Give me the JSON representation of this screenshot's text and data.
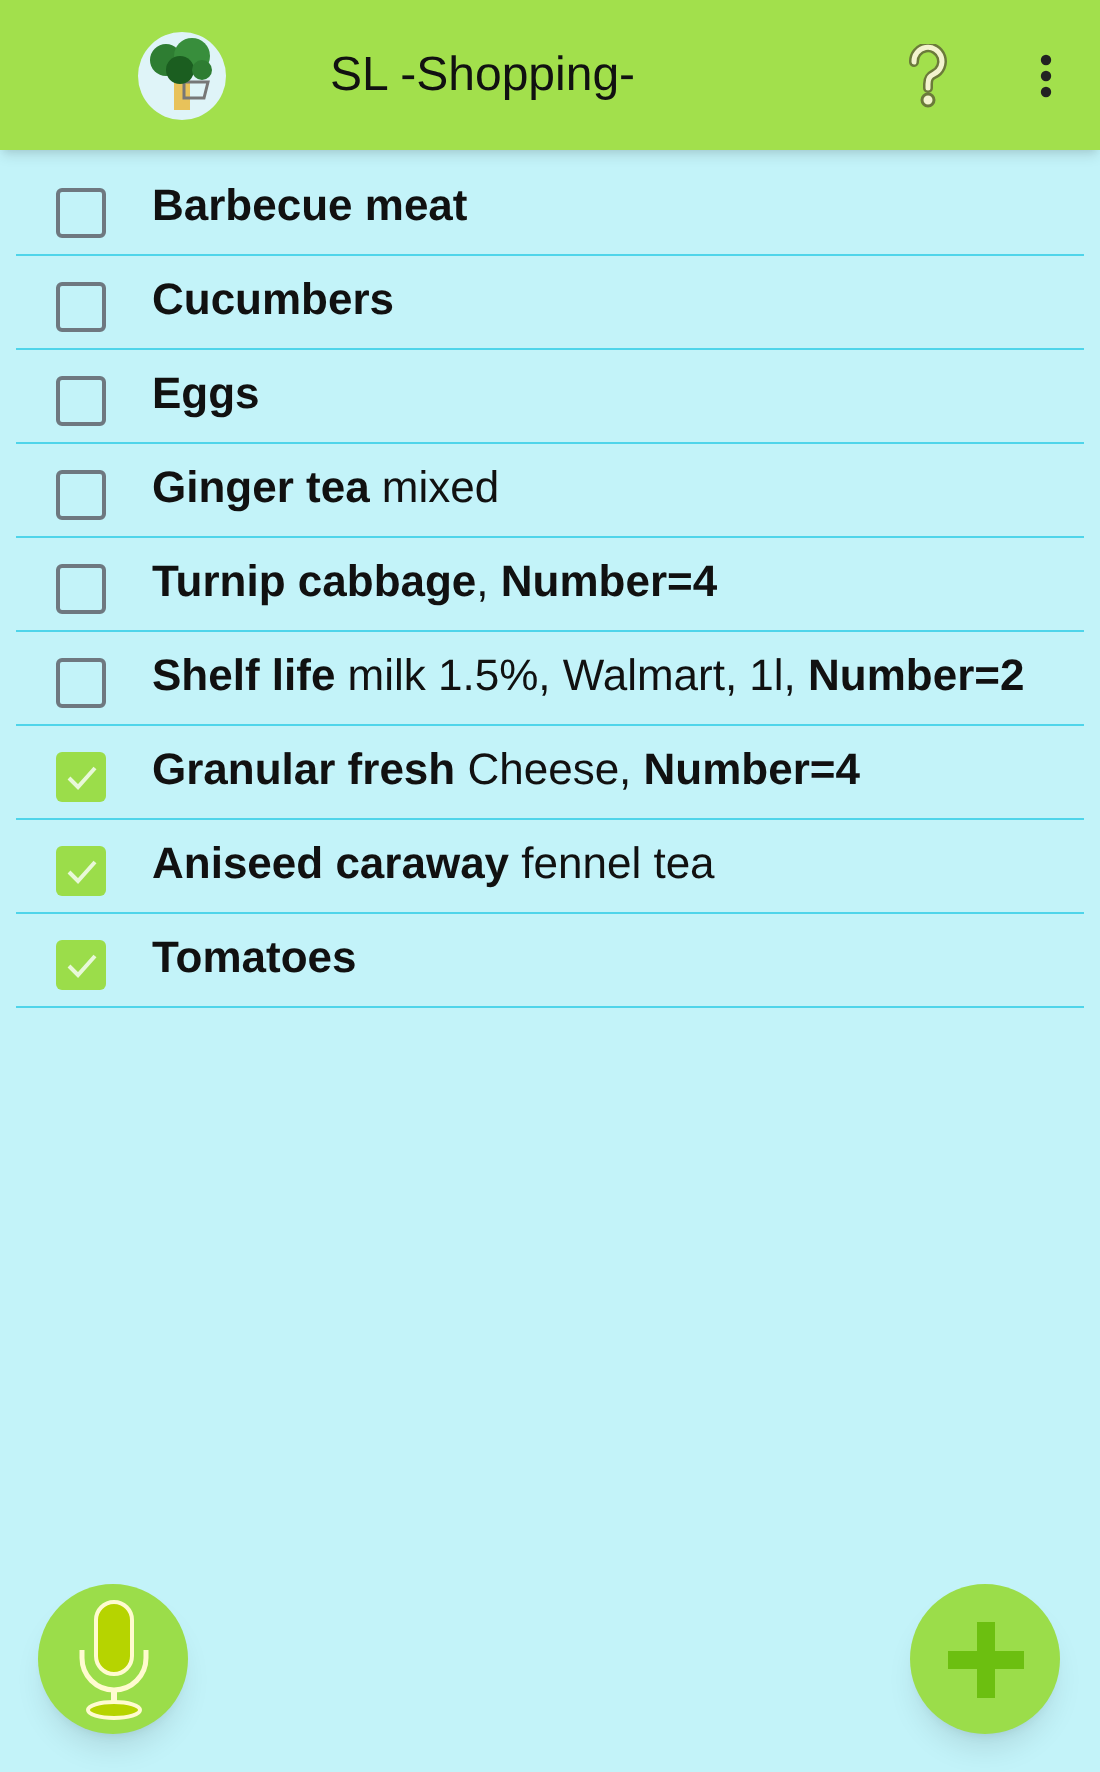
{
  "app_bar": {
    "title": "SL -Shopping-"
  },
  "items": [
    {
      "name": "Barbecue meat",
      "checked": false
    },
    {
      "name": "Cucumbers",
      "checked": false
    },
    {
      "name": "Eggs",
      "checked": false
    },
    {
      "name": "Ginger tea",
      "detail": " mixed",
      "checked": false
    },
    {
      "name": "Turnip cabbage",
      "detail": ", **Number=4**",
      "checked": false
    },
    {
      "name": "Shelf life",
      "detail": " milk 1.5%, Walmart, 1l, **Number=2**",
      "checked": false
    },
    {
      "name": "Granular fresh",
      "detail": " Cheese, **Number=4**",
      "checked": true
    },
    {
      "name": "Aniseed caraway",
      "detail": " fennel tea",
      "checked": true
    },
    {
      "name": "Tomatoes",
      "checked": true
    }
  ]
}
